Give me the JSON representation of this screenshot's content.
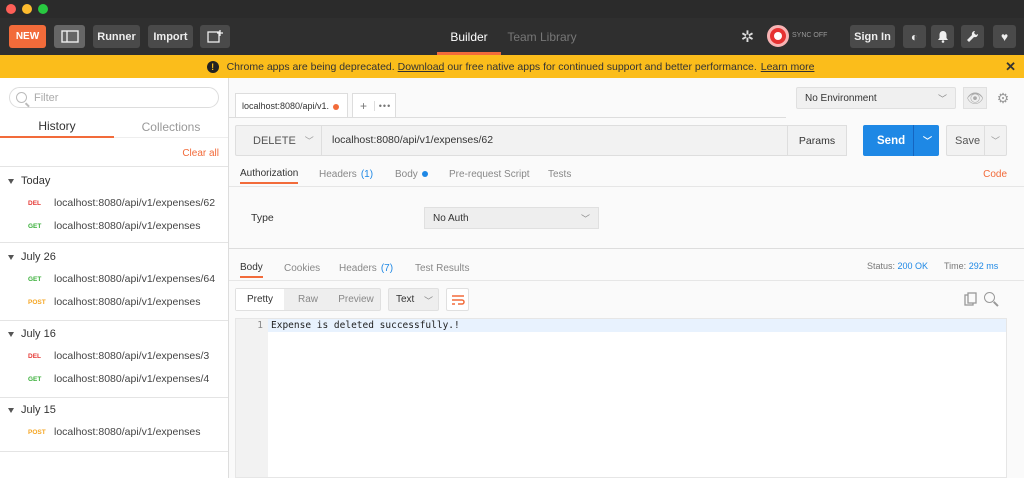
{
  "header": {
    "new_label": "NEW",
    "runner_label": "Runner",
    "import_label": "Import",
    "tab_builder": "Builder",
    "tab_team_library": "Team Library",
    "sync_status": "SYNC OFF",
    "signin_label": "Sign In"
  },
  "banner": {
    "text_before": "Chrome apps are being deprecated.",
    "download_link": "Download",
    "text_after": "our free native apps for continued support and better performance.",
    "learn_more": "Learn more"
  },
  "sidebar": {
    "filter_placeholder": "Filter",
    "tab_history": "History",
    "tab_collections": "Collections",
    "clear_all": "Clear all",
    "groups": [
      {
        "label": "Today",
        "items": [
          {
            "method": "DEL",
            "url": "localhost:8080/api/v1/expenses/62"
          },
          {
            "method": "GET",
            "url": "localhost:8080/api/v1/expenses"
          }
        ]
      },
      {
        "label": "July 26",
        "items": [
          {
            "method": "GET",
            "url": "localhost:8080/api/v1/expenses/64"
          },
          {
            "method": "POST",
            "url": "localhost:8080/api/v1/expenses"
          }
        ]
      },
      {
        "label": "July 16",
        "items": [
          {
            "method": "DEL",
            "url": "localhost:8080/api/v1/expenses/3"
          },
          {
            "method": "GET",
            "url": "localhost:8080/api/v1/expenses/4"
          }
        ]
      },
      {
        "label": "July 15",
        "items": [
          {
            "method": "POST",
            "url": "localhost:8080/api/v1/expenses"
          }
        ]
      }
    ]
  },
  "request": {
    "tab_label": "localhost:8080/api/v1.",
    "environment": "No Environment",
    "method": "DELETE",
    "url": "localhost:8080/api/v1/expenses/62",
    "params_label": "Params",
    "send_label": "Send",
    "save_label": "Save",
    "tabs": {
      "authorization": "Authorization",
      "headers": "Headers",
      "headers_count": "(1)",
      "body": "Body",
      "prerequest": "Pre-request Script",
      "tests": "Tests"
    },
    "code_link": "Code",
    "auth_type_label": "Type",
    "auth_type_value": "No Auth"
  },
  "response": {
    "tabs": {
      "body": "Body",
      "cookies": "Cookies",
      "headers": "Headers",
      "headers_count": "(7)",
      "test_results": "Test Results"
    },
    "status_label": "Status:",
    "status_value": "200 OK",
    "time_label": "Time:",
    "time_value": "292 ms",
    "format_pretty": "Pretty",
    "format_raw": "Raw",
    "format_preview": "Preview",
    "content_type": "Text",
    "line_number": "1",
    "body_text": "Expense is deleted successfully.!"
  },
  "colors": {
    "accent": "#f26b3a",
    "send_blue": "#1e88e5",
    "banner_yellow": "#fbbd1b",
    "method_del": "#e53935",
    "method_get": "#3aaf3a",
    "method_post": "#f5a623"
  }
}
